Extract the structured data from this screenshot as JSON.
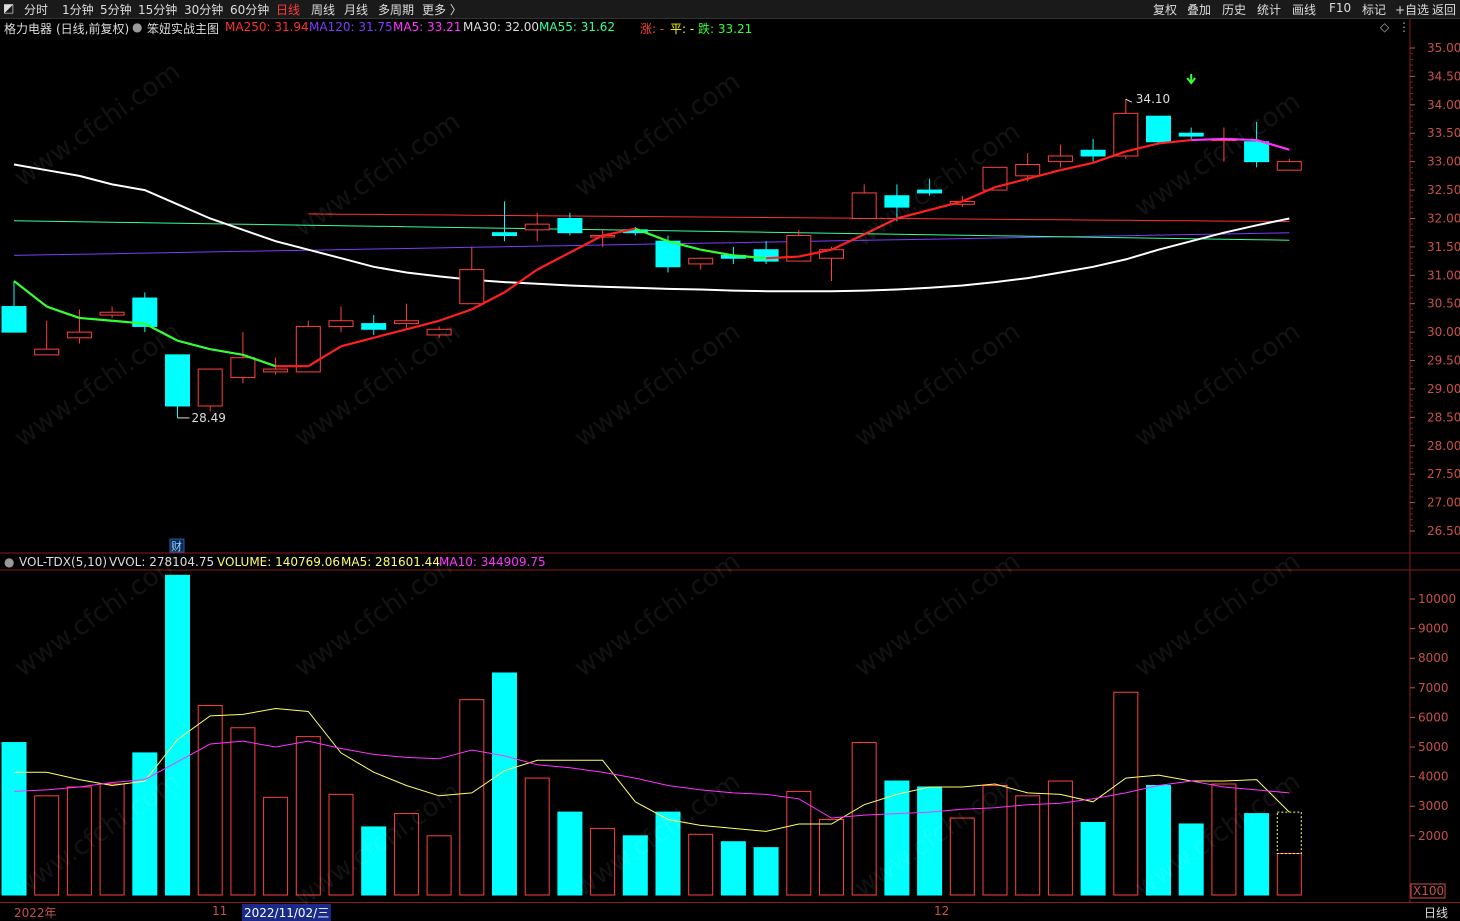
{
  "toolbar": {
    "left_tabs": [
      "分时",
      "1分钟",
      "5分钟",
      "15分钟",
      "30分钟",
      "60分钟",
      "日线",
      "周线",
      "月线",
      "多周期",
      "更多 〉"
    ],
    "active_tab": "日线",
    "right_buttons": [
      "复权",
      "叠加",
      "历史",
      "统计",
      "画线",
      "F10",
      "标记",
      "+自选",
      "返回"
    ]
  },
  "price_info": {
    "stock": "格力电器",
    "mode": "(日线,前复权)",
    "indicator": "笨妞实战主图",
    "ma250": "MA250: 31.94",
    "ma120": "MA120: 31.75",
    "ma5": "MA5: 33.21",
    "ma30": "MA30: 32.00",
    "ma55": "MA55: 31.62",
    "zhang": "涨: -",
    "ping": "平: -",
    "die": "跌: 33.21"
  },
  "annotations": {
    "high_label": "34.10",
    "low_label": "28.49",
    "fin_marker": "财"
  },
  "price_axis": [
    "35.00",
    "34.50",
    "34.00",
    "33.50",
    "33.00",
    "32.50",
    "32.00",
    "31.50",
    "31.00",
    "30.50",
    "30.00",
    "29.50",
    "29.00",
    "28.50",
    "28.00",
    "27.50",
    "27.00",
    "26.50"
  ],
  "volume_info": {
    "name": "VOL-TDX(5,10)",
    "vvol": "VVOL: 278104.75",
    "volume": "VOLUME: 140769.06",
    "ma5": "MA5: 281601.44",
    "ma10": "MA10: 344909.75"
  },
  "volume_axis": [
    "10000",
    "9000",
    "8000",
    "7000",
    "6000",
    "5000",
    "4000",
    "3000",
    "2000",
    "X100"
  ],
  "dates": {
    "year": "2022年",
    "m11": "11",
    "cursor": "2022/11/02/三",
    "m12": "12",
    "period": "日线"
  },
  "watermark": "www.cfchi.com",
  "colors": {
    "up": "#ff4040",
    "down": "#00ffff",
    "ma250": "#ff3030",
    "ma120": "#7b3cff",
    "ma5": "#ff33ff",
    "ma30": "#ffffff",
    "ma55": "#33ff99",
    "vol_ma5": "#ffff66",
    "vol_ma10": "#ff33ff"
  },
  "candles": [
    {
      "o": 30.45,
      "c": 30.0,
      "h": 30.9,
      "l": 30.0
    },
    {
      "o": 29.6,
      "c": 29.7,
      "h": 30.2,
      "l": 29.6
    },
    {
      "o": 29.9,
      "c": 30.0,
      "h": 30.4,
      "l": 29.8
    },
    {
      "o": 30.3,
      "c": 30.35,
      "h": 30.45,
      "l": 30.25
    },
    {
      "o": 30.6,
      "c": 30.1,
      "h": 30.7,
      "l": 30.0
    },
    {
      "o": 29.6,
      "c": 28.7,
      "h": 29.6,
      "l": 28.49
    },
    {
      "o": 28.7,
      "c": 29.35,
      "h": 29.35,
      "l": 28.6
    },
    {
      "o": 29.2,
      "c": 29.55,
      "h": 30.0,
      "l": 29.1
    },
    {
      "o": 29.3,
      "c": 29.35,
      "h": 29.55,
      "l": 29.25
    },
    {
      "o": 29.3,
      "c": 30.1,
      "h": 30.2,
      "l": 29.3
    },
    {
      "o": 30.1,
      "c": 30.2,
      "h": 30.45,
      "l": 30.0
    },
    {
      "o": 30.15,
      "c": 30.05,
      "h": 30.3,
      "l": 29.95
    },
    {
      "o": 30.15,
      "c": 30.2,
      "h": 30.5,
      "l": 30.05
    },
    {
      "o": 29.95,
      "c": 30.05,
      "h": 30.1,
      "l": 29.9
    },
    {
      "o": 30.5,
      "c": 31.1,
      "h": 31.5,
      "l": 30.5
    },
    {
      "o": 31.75,
      "c": 31.7,
      "h": 32.3,
      "l": 31.6
    },
    {
      "o": 31.8,
      "c": 31.9,
      "h": 32.1,
      "l": 31.6
    },
    {
      "o": 32.0,
      "c": 31.75,
      "h": 32.1,
      "l": 31.7
    },
    {
      "o": 31.7,
      "c": 31.7,
      "h": 31.8,
      "l": 31.5
    },
    {
      "o": 31.8,
      "c": 31.75,
      "h": 31.85,
      "l": 31.7
    },
    {
      "o": 31.6,
      "c": 31.15,
      "h": 31.7,
      "l": 31.05
    },
    {
      "o": 31.2,
      "c": 31.3,
      "h": 31.3,
      "l": 31.1
    },
    {
      "o": 31.35,
      "c": 31.3,
      "h": 31.5,
      "l": 31.2
    },
    {
      "o": 31.45,
      "c": 31.25,
      "h": 31.6,
      "l": 31.2
    },
    {
      "o": 31.25,
      "c": 31.7,
      "h": 31.8,
      "l": 31.25
    },
    {
      "o": 31.3,
      "c": 31.45,
      "h": 31.5,
      "l": 30.9
    },
    {
      "o": 32.0,
      "c": 32.45,
      "h": 32.6,
      "l": 32.0
    },
    {
      "o": 32.4,
      "c": 32.2,
      "h": 32.6,
      "l": 31.95
    },
    {
      "o": 32.5,
      "c": 32.45,
      "h": 32.7,
      "l": 32.4
    },
    {
      "o": 32.25,
      "c": 32.3,
      "h": 32.4,
      "l": 32.2
    },
    {
      "o": 32.5,
      "c": 32.9,
      "h": 32.9,
      "l": 32.5
    },
    {
      "o": 32.75,
      "c": 32.95,
      "h": 33.15,
      "l": 32.65
    },
    {
      "o": 33.0,
      "c": 33.1,
      "h": 33.3,
      "l": 32.9
    },
    {
      "o": 33.2,
      "c": 33.1,
      "h": 33.4,
      "l": 33.0
    },
    {
      "o": 33.1,
      "c": 33.85,
      "h": 34.1,
      "l": 33.05
    },
    {
      "o": 33.8,
      "c": 33.35,
      "h": 33.8,
      "l": 33.3
    },
    {
      "o": 33.5,
      "c": 33.45,
      "h": 33.6,
      "l": 33.4
    },
    {
      "o": 33.4,
      "c": 33.4,
      "h": 33.6,
      "l": 33.0
    },
    {
      "o": 33.35,
      "c": 33.0,
      "h": 33.7,
      "l": 32.9
    },
    {
      "o": 32.85,
      "c": 33.0,
      "h": 33.05,
      "l": 32.85
    }
  ],
  "volumes": [
    5150,
    3350,
    3650,
    3750,
    4800,
    10800,
    6400,
    5650,
    3300,
    5350,
    3400,
    2300,
    2750,
    2000,
    6600,
    7500,
    3950,
    2800,
    2250,
    2000,
    2800,
    2050,
    1800,
    1600,
    3500,
    2550,
    5150,
    3850,
    3650,
    2600,
    3700,
    3350,
    3850,
    2450,
    6850,
    3700,
    2400,
    3750,
    2750,
    1400
  ],
  "ma30_line": [
    32.95,
    32.85,
    32.75,
    32.6,
    32.5,
    32.25,
    32.0,
    31.8,
    31.6,
    31.45,
    31.3,
    31.15,
    31.05,
    30.98,
    30.92,
    30.88,
    30.85,
    30.82,
    30.8,
    30.78,
    30.76,
    30.75,
    30.73,
    30.72,
    30.72,
    30.72,
    30.73,
    30.75,
    30.78,
    30.82,
    30.88,
    30.95,
    31.05,
    31.15,
    31.28,
    31.45,
    31.6,
    31.75,
    31.88,
    32.0
  ],
  "ma5_line": [
    30.9,
    30.45,
    30.25,
    30.2,
    30.15,
    29.85,
    29.7,
    29.6,
    29.4,
    29.4,
    29.75,
    29.9,
    30.05,
    30.2,
    30.4,
    30.7,
    31.1,
    31.4,
    31.7,
    31.82,
    31.6,
    31.45,
    31.35,
    31.3,
    31.33,
    31.45,
    31.72,
    32.0,
    32.15,
    32.3,
    32.55,
    32.7,
    32.85,
    32.98,
    33.18,
    33.32,
    33.38,
    33.4,
    33.38,
    33.21
  ],
  "vol_ma5_line": [
    4150,
    4150,
    3900,
    3700,
    3850,
    5250,
    6050,
    6100,
    6300,
    6200,
    4800,
    4150,
    3700,
    3350,
    3450,
    4200,
    4550,
    4550,
    4550,
    3150,
    2550,
    2350,
    2250,
    2150,
    2400,
    2400,
    3050,
    3400,
    3650,
    3650,
    3750,
    3450,
    3400,
    3150,
    3950,
    4050,
    3850,
    3850,
    3900,
    2800
  ],
  "vol_ma10_line": [
    3500,
    3550,
    3650,
    3800,
    3900,
    4500,
    5100,
    5200,
    5000,
    5200,
    4950,
    4750,
    4650,
    4600,
    4900,
    4700,
    4400,
    4300,
    4150,
    3950,
    3700,
    3550,
    3450,
    3400,
    3250,
    2600,
    2700,
    2750,
    2800,
    2900,
    2950,
    3050,
    3100,
    3250,
    3450,
    3700,
    3850,
    3650,
    3550,
    3450
  ]
}
